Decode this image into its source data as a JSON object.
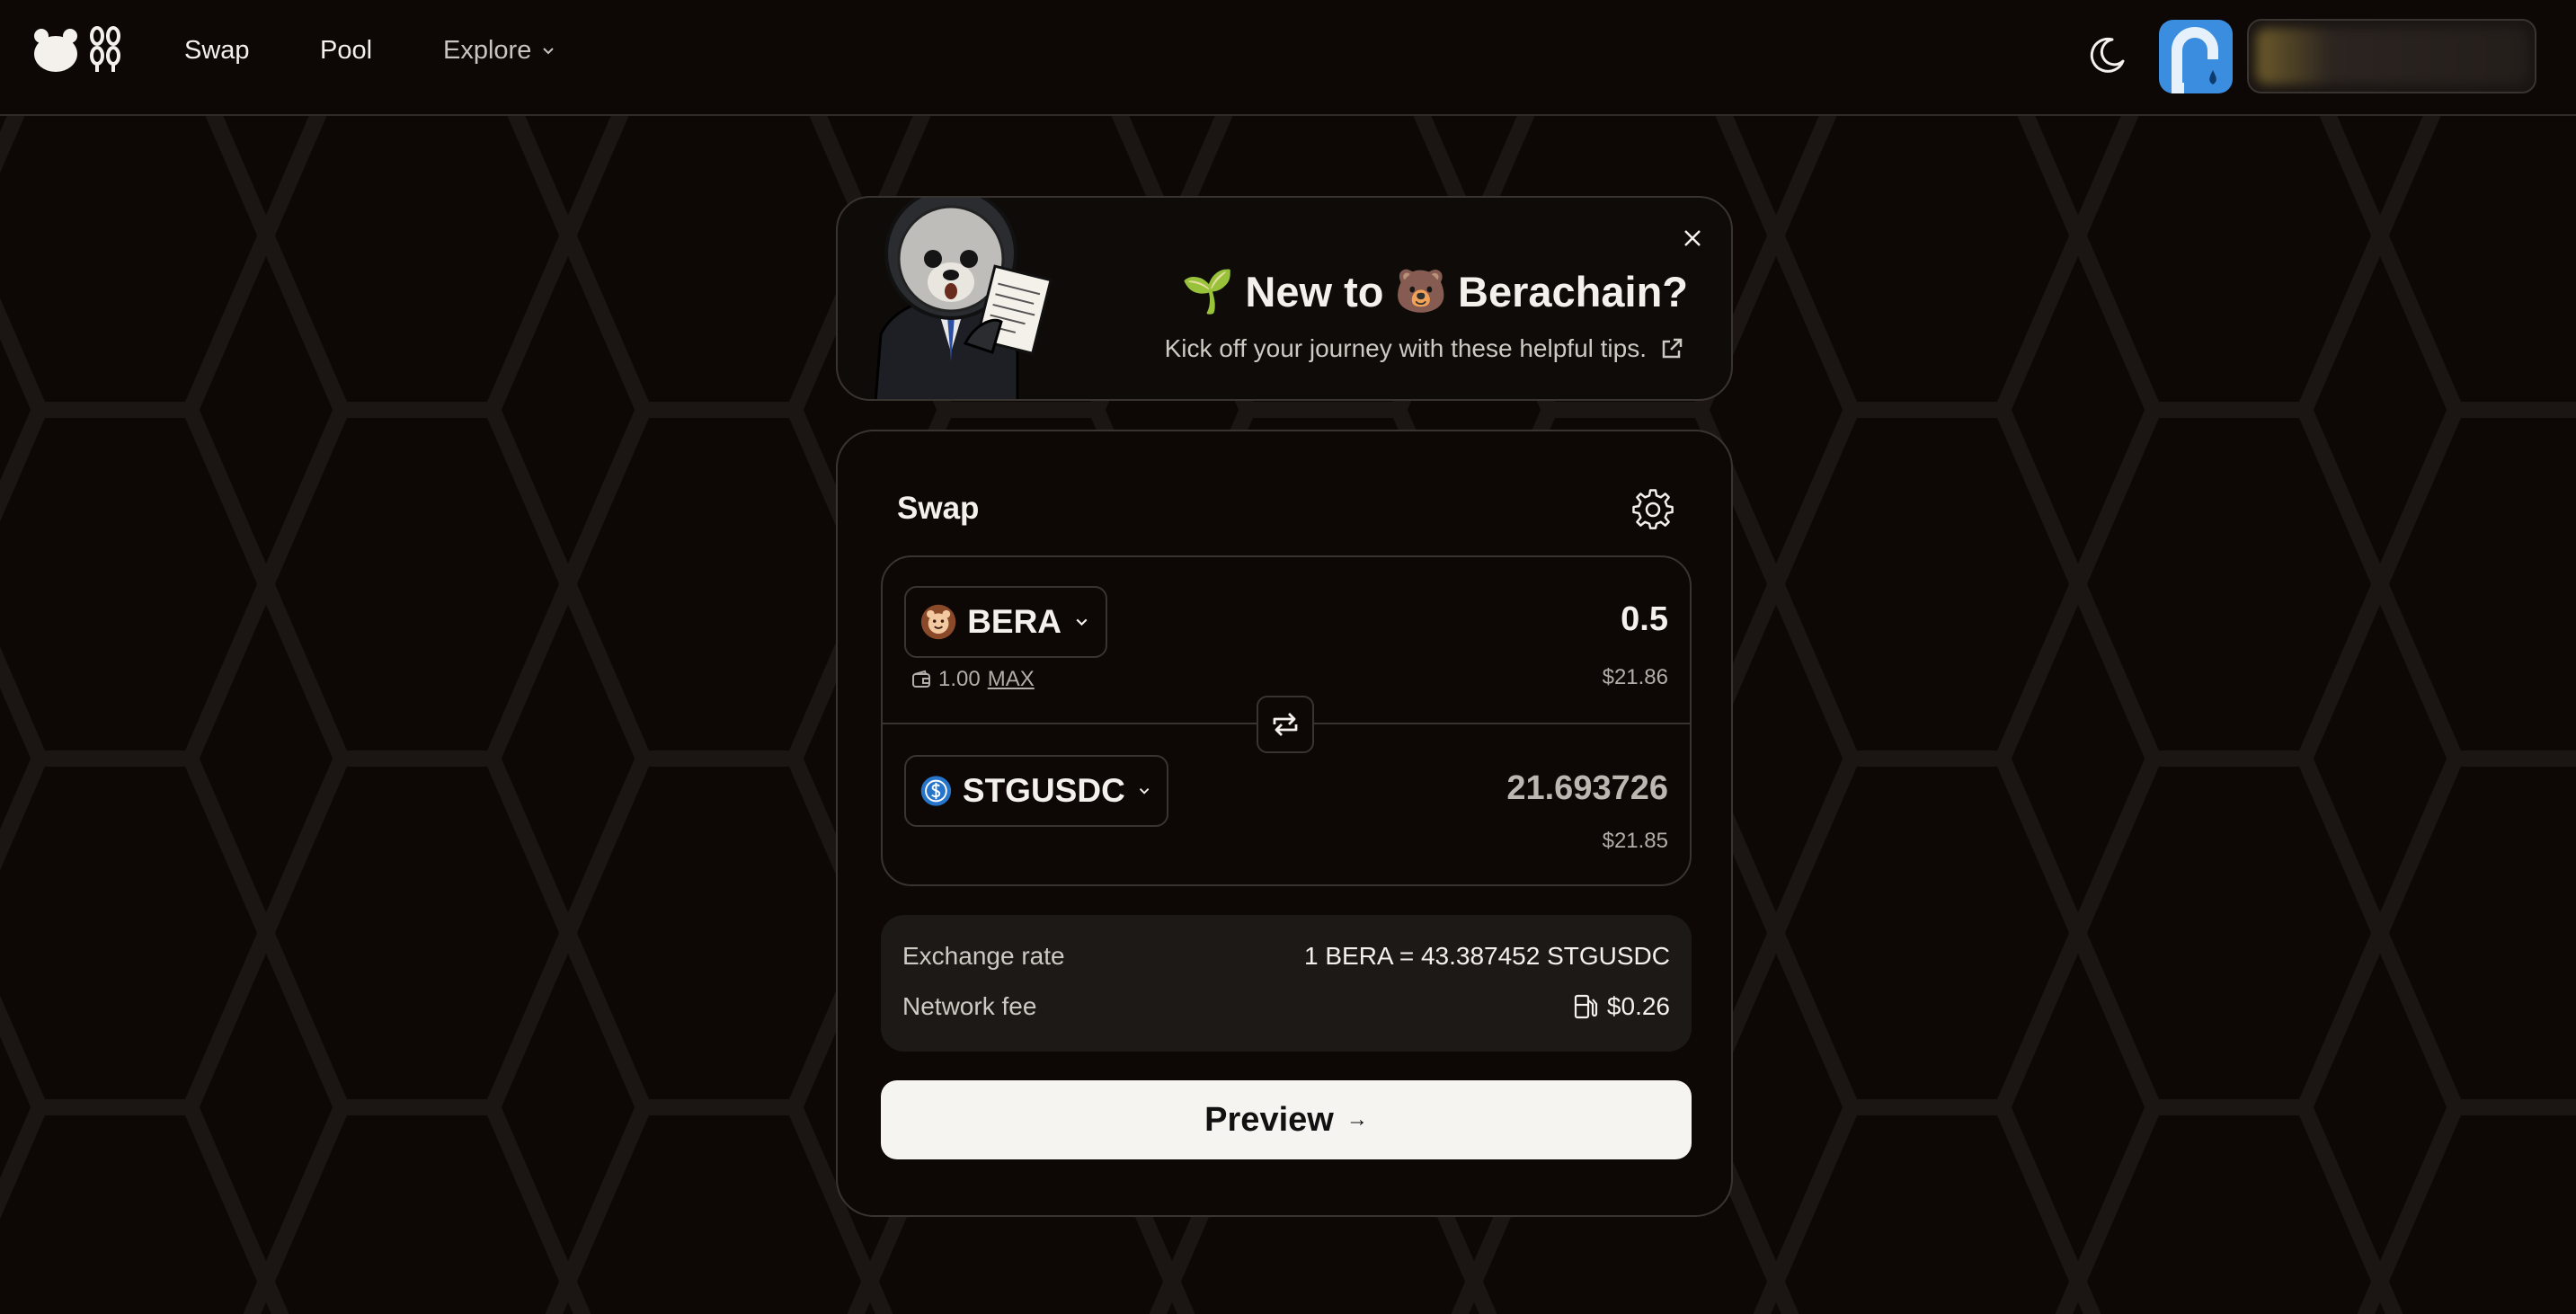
{
  "header": {
    "nav": {
      "swap": "Swap",
      "pool": "Pool",
      "explore": "Explore"
    },
    "icons": {
      "logo": "berachain-logo-icon",
      "theme": "moon-icon",
      "faucet": "faucet-icon"
    }
  },
  "banner": {
    "title_prefix": "🌱",
    "title_new": "New to",
    "title_bear": "🐻",
    "title_brand": "Berachain?",
    "subtitle": "Kick off your journey with these helpful tips."
  },
  "swap": {
    "title": "Swap",
    "from": {
      "symbol": "BERA",
      "amount": "0.5",
      "usd": "$21.86",
      "balance": "1.00",
      "max_label": "MAX"
    },
    "to": {
      "symbol": "STGUSDC",
      "amount": "21.693726",
      "usd": "$21.85"
    },
    "details": {
      "rate_label": "Exchange rate",
      "rate_value": "1 BERA = 43.387452 STGUSDC",
      "fee_label": "Network fee",
      "fee_value": "$0.26"
    },
    "preview_label": "Preview",
    "preview_arrow": "→"
  },
  "colors": {
    "background": "#0d0806",
    "border": "#3a3430",
    "faucet_blue": "#3b8de0",
    "usdc_blue": "#2775ca",
    "bera_brown": "#8a4a2a"
  }
}
